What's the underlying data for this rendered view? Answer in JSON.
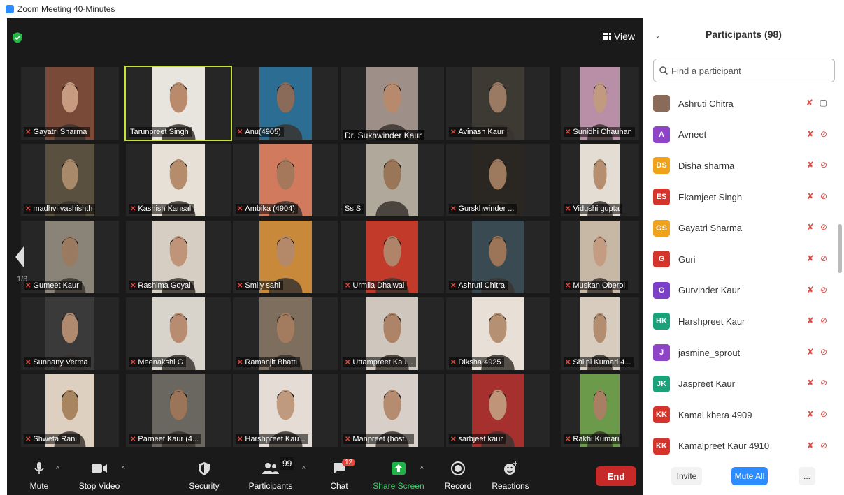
{
  "window": {
    "title": "Zoom Meeting 40-Minutes"
  },
  "meeting": {
    "view_label": "View",
    "page_indicator": "1/3"
  },
  "tiles": [
    {
      "name": "Gayatri Sharma",
      "skin": "#c79b80",
      "bg": "#7a4a38"
    },
    {
      "name": "Tarunpreet Singh",
      "skin": "#b98a6c",
      "bg": "#e8e4de"
    },
    {
      "name": "Anu(4905)",
      "skin": "#8a6a58",
      "bg": "#2b6d93"
    },
    {
      "name": "Dr. Sukhwinder Kaur",
      "skin": "#b78a6e",
      "bg": "#9e9088"
    },
    {
      "name": "Avinash Kaur",
      "skin": "#9a7a62",
      "bg": "#3c3a33"
    },
    {
      "name": "Sunidhi Chauhan",
      "skin": "#c29a80",
      "bg": "#b88fa6"
    },
    {
      "name": "madhvi vashishth",
      "skin": "#a88a6a",
      "bg": "#5a5040"
    },
    {
      "name": "Kashish Kansal",
      "skin": "#b58c6c",
      "bg": "#e6e0d6"
    },
    {
      "name": "Ambika (4904)",
      "skin": "#a5785c",
      "bg": "#d27a5e"
    },
    {
      "name": "Ss S",
      "skin": "#9a7658",
      "bg": "#b0a89b"
    },
    {
      "name": "Gurskhwinder ...",
      "skin": "#9d7a5e",
      "bg": "#2a2722"
    },
    {
      "name": "Vidushi gupta",
      "skin": "#b58f70",
      "bg": "#e4ddd4"
    },
    {
      "name": "Gumeet Kaur",
      "skin": "#9a7a60",
      "bg": "#8a8478"
    },
    {
      "name": "Rashima Goyal",
      "skin": "#c09478",
      "bg": "#d6cec2"
    },
    {
      "name": "Smily sahi",
      "skin": "#b4896a",
      "bg": "#c88a3a"
    },
    {
      "name": "Urmila Dhalwal",
      "skin": "#b08468",
      "bg": "#c13a2a"
    },
    {
      "name": "Ashruti Chitra",
      "skin": "#9c7558",
      "bg": "#3a4a52"
    },
    {
      "name": "Muskan Oberoi",
      "skin": "#c39c82",
      "bg": "#c7b7a5"
    },
    {
      "name": "Sunnany Verma",
      "skin": "#b08a6e",
      "bg": "#3a3a3a"
    },
    {
      "name": "Meenakshi G",
      "skin": "#b88c70",
      "bg": "#d8d4cc"
    },
    {
      "name": "Ramanjit Bhatti",
      "skin": "#a37b5e",
      "bg": "#7d6e5e"
    },
    {
      "name": "Uttampreet Kau...",
      "skin": "#ad8468",
      "bg": "#cfc7bd"
    },
    {
      "name": "Diksha 4925",
      "skin": "#b69072",
      "bg": "#e8e0d6"
    },
    {
      "name": "Shilpi Kumari 4...",
      "skin": "#b38d70",
      "bg": "#d7ccbe"
    },
    {
      "name": "Shweta Rani",
      "skin": "#a8845f",
      "bg": "#ddd0c0"
    },
    {
      "name": "Parneet Kaur (4...",
      "skin": "#9c7558",
      "bg": "#6a6660"
    },
    {
      "name": "Harshpreet Kau...",
      "skin": "#c09a7e",
      "bg": "#e5ddd5"
    },
    {
      "name": "Manpreet (host...",
      "skin": "#b58c70",
      "bg": "#d8d0c8"
    },
    {
      "name": "sarbjeet kaur",
      "skin": "#c09478",
      "bg": "#a5302e"
    },
    {
      "name": "Rakhi Kumari",
      "skin": "#a87f62",
      "bg": "#6a9a4a"
    }
  ],
  "toolbar": {
    "mute": "Mute",
    "stop_video": "Stop Video",
    "security": "Security",
    "participants": "Participants",
    "participants_count": "99",
    "chat": "Chat",
    "chat_badge": "12",
    "share_screen": "Share Screen",
    "record": "Record",
    "reactions": "Reactions",
    "end": "End"
  },
  "panel": {
    "title": "Participants (98)",
    "search_placeholder": "Find a participant",
    "invite": "Invite",
    "mute_all": "Mute All",
    "more": "...",
    "participants": [
      {
        "name": "Ashruti Chitra",
        "initials": "",
        "color": "#8a6a58",
        "video": "on"
      },
      {
        "name": "Avneet",
        "initials": "A",
        "color": "#8e44c6",
        "video": "off"
      },
      {
        "name": "Disha sharma",
        "initials": "DS",
        "color": "#f0a31a",
        "video": "off"
      },
      {
        "name": "Ekamjeet Singh",
        "initials": "ES",
        "color": "#d4342b",
        "video": "off"
      },
      {
        "name": "Gayatri Sharma",
        "initials": "GS",
        "color": "#f0a31a",
        "video": "off"
      },
      {
        "name": "Guri",
        "initials": "G",
        "color": "#d4342b",
        "video": "off"
      },
      {
        "name": "Gurvinder Kaur",
        "initials": "G",
        "color": "#7b3fc8",
        "video": "off"
      },
      {
        "name": "Harshpreet Kaur",
        "initials": "HK",
        "color": "#1aa37a",
        "video": "off"
      },
      {
        "name": "jasmine_sprout",
        "initials": "J",
        "color": "#8e44c6",
        "video": "off"
      },
      {
        "name": "Jaspreet Kaur",
        "initials": "JK",
        "color": "#1aa37a",
        "video": "off"
      },
      {
        "name": "Kamal khera 4909",
        "initials": "KK",
        "color": "#d4342b",
        "video": "off"
      },
      {
        "name": "Kamalpreet Kaur 4910",
        "initials": "KK",
        "color": "#d4342b",
        "video": "off"
      }
    ]
  }
}
